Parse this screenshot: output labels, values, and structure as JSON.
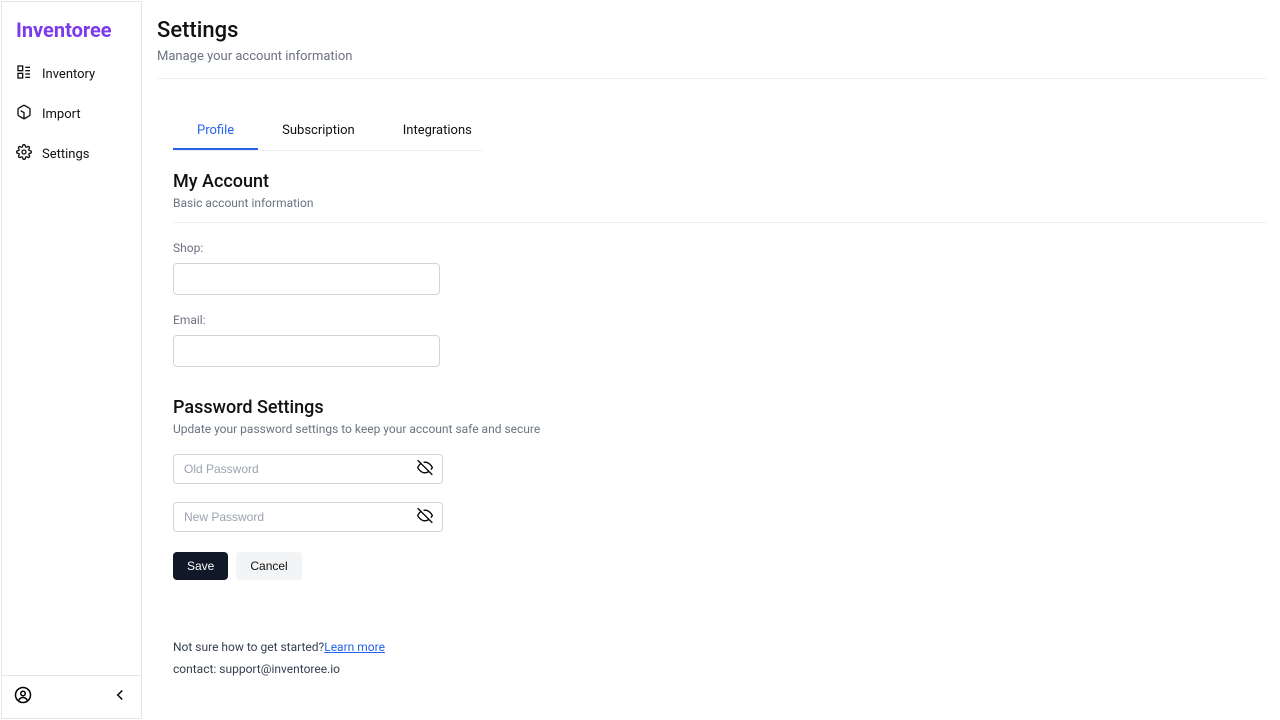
{
  "app": {
    "name": "Inventoree"
  },
  "sidebar": {
    "items": [
      {
        "label": "Inventory"
      },
      {
        "label": "Import"
      },
      {
        "label": "Settings"
      }
    ]
  },
  "header": {
    "title": "Settings",
    "subtitle": "Manage your account information"
  },
  "tabs": [
    {
      "label": "Profile",
      "active": true
    },
    {
      "label": "Subscription",
      "active": false
    },
    {
      "label": "Integrations",
      "active": false
    }
  ],
  "account": {
    "title": "My Account",
    "description": "Basic account information",
    "shop_label": "Shop:",
    "shop_value": "",
    "email_label": "Email:",
    "email_value": ""
  },
  "password": {
    "title": "Password Settings",
    "description": "Update your password settings to keep your account safe and secure",
    "old_placeholder": "Old Password",
    "new_placeholder": "New Password",
    "old_value": "",
    "new_value": ""
  },
  "buttons": {
    "save": "Save",
    "cancel": "Cancel"
  },
  "footer": {
    "help_text": "Not sure how to get started?",
    "learn_more": "Learn more",
    "contact": "contact: support@inventoree.io"
  }
}
